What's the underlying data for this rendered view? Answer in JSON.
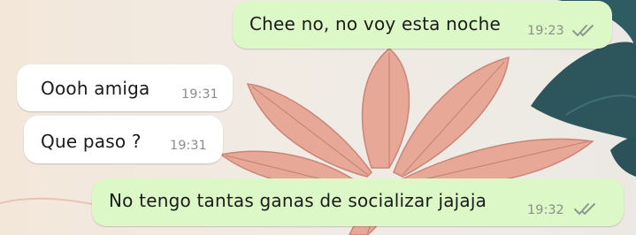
{
  "theme": {
    "outgoing_bubble": "#dcf8c6",
    "incoming_bubble": "#ffffff",
    "read_ticks": "#8c9a8c",
    "wallpaper_base": "#f4ece1",
    "leaf_color": "#e9ab9a",
    "dark_leaf_color": "#2d5a5f"
  },
  "messages": [
    {
      "direction": "out",
      "text": "Chee no, no voy esta noche",
      "time": "19:23",
      "status_icon": "double-check-read-icon"
    },
    {
      "direction": "in",
      "text": "Oooh amiga",
      "time": "19:31"
    },
    {
      "direction": "in",
      "text": "Que paso ?",
      "time": "19:31"
    },
    {
      "direction": "out",
      "text": "No tengo tantas ganas de socializar jajaja",
      "time": "19:32",
      "status_icon": "double-check-read-icon"
    }
  ]
}
